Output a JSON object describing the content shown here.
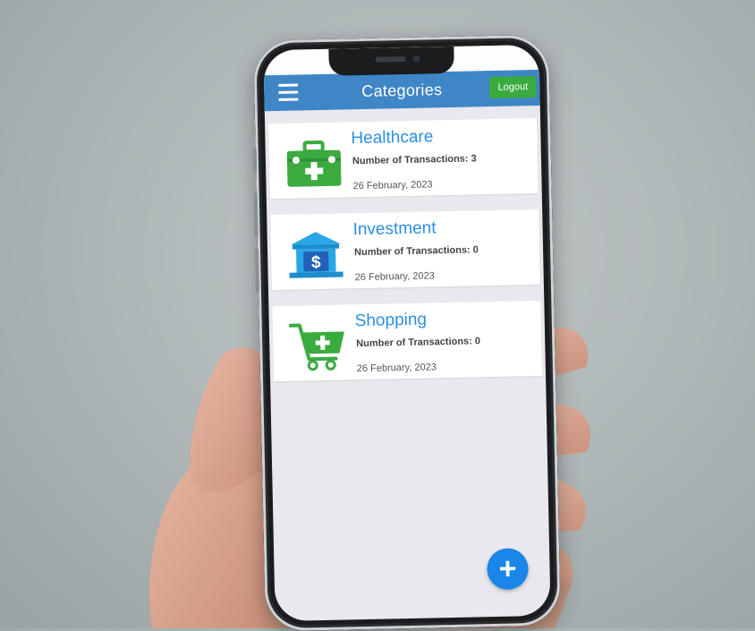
{
  "appbar": {
    "title": "Categories",
    "logout_label": "Logout"
  },
  "categories": [
    {
      "name": "Healthcare",
      "transactions": "Number of Transactions: 3",
      "date": "26 February, 2023",
      "icon": "medical-kit-icon"
    },
    {
      "name": "Investment",
      "transactions": "Number of Transactions: 0",
      "date": "26 February, 2023",
      "icon": "bank-icon"
    },
    {
      "name": "Shopping",
      "transactions": "Number of Transactions: 0",
      "date": "26 February, 2023",
      "icon": "shopping-cart-icon"
    }
  ],
  "fab": {
    "label": "+"
  },
  "colors": {
    "appbar": "#3f86c6",
    "logout": "#3bab3f",
    "category_name": "#2b8fe6",
    "fab": "#1a86e8"
  }
}
